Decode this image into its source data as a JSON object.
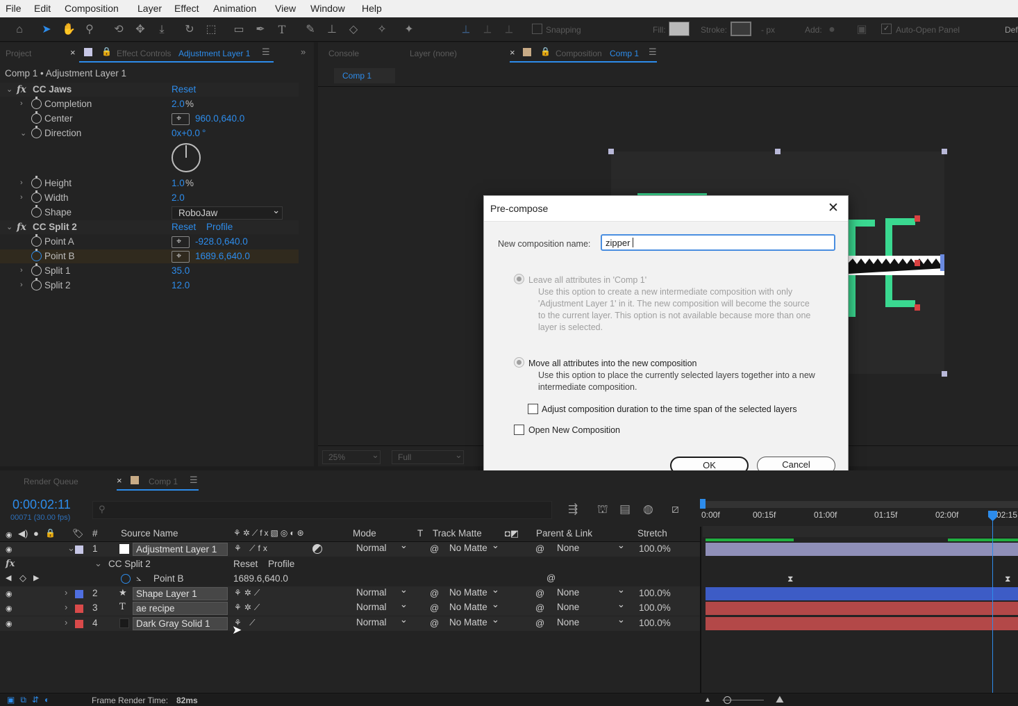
{
  "menu": [
    "File",
    "Edit",
    "Composition",
    "Layer",
    "Effect",
    "Animation",
    "View",
    "Window",
    "Help"
  ],
  "toolbar": {
    "snapping": "Snapping",
    "fill": "Fill:",
    "stroke": "Stroke:",
    "stroke_px": "- px",
    "add": "Add:",
    "auto_open": "Auto-Open Panel",
    "workspace": "Def"
  },
  "left_panel": {
    "tab_project": "Project",
    "tab_effect_controls": "Effect Controls",
    "tab_effect_target": "Adjustment Layer 1",
    "header": "Comp 1 • Adjustment Layer 1",
    "effects": [
      {
        "name": "CC Jaws",
        "reset": "Reset",
        "props": [
          {
            "label": "Completion",
            "value": "2.0",
            "unit": "%"
          },
          {
            "label": "Center",
            "value": "960.0,640.0"
          },
          {
            "label": "Direction",
            "value": "0x+0.0",
            "unit": "°"
          },
          {
            "label": "Height",
            "value": "1.0",
            "unit": "%"
          },
          {
            "label": "Width",
            "value": "2.0"
          },
          {
            "label": "Shape",
            "value": "RoboJaw"
          }
        ]
      },
      {
        "name": "CC Split 2",
        "reset": "Reset",
        "profile": "Profile",
        "props": [
          {
            "label": "Point A",
            "value": "-928.0,640.0"
          },
          {
            "label": "Point B",
            "value": "1689.6,640.0"
          },
          {
            "label": "Split 1",
            "value": "35.0"
          },
          {
            "label": "Split 2",
            "value": "12.0"
          }
        ]
      }
    ]
  },
  "comp_panel": {
    "tab_console": "Console",
    "tab_layer": "Layer (none)",
    "tab_composition": "Composition",
    "tab_comp_name": "Comp 1",
    "breadcrumb": "Comp 1",
    "zoom": "25%",
    "resolution": "Full"
  },
  "dialog": {
    "title": "Pre-compose",
    "name_label": "New composition name:",
    "name_value": "zipper",
    "opt1_label": "Leave all attributes in 'Comp 1'",
    "opt1_desc": [
      "Use this option to create a new intermediate composition with only",
      "'Adjustment Layer 1' in it. The new composition will become the source",
      "to the current layer. This option is not available because more than one",
      "layer is selected."
    ],
    "opt2_label": "Move all attributes into the new composition",
    "opt2_desc": [
      "Use this option to place the currently selected layers together into a new",
      "intermediate composition."
    ],
    "adjust_duration": "Adjust composition duration to the time span of the selected layers",
    "open_new": "Open New Composition",
    "ok": "OK",
    "cancel": "Cancel"
  },
  "timeline": {
    "tab_render_queue": "Render Queue",
    "tab_comp": "Comp 1",
    "timecode": "0:00:02:11",
    "frame_info": "00071 (30.00 fps)",
    "columns": {
      "num": "#",
      "source_name": "Source Name",
      "mode": "Mode",
      "t": "T",
      "track_matte": "Track Matte",
      "parent_link": "Parent & Link",
      "stretch": "Stretch"
    },
    "ruler": [
      "0:00f",
      "00:15f",
      "01:00f",
      "01:15f",
      "02:00f",
      "02:15"
    ],
    "layers": [
      {
        "num": "1",
        "name": "Adjustment Layer 1",
        "mode": "Normal",
        "matte": "No Matte",
        "parent": "None",
        "stretch": "100.0%",
        "color": "#c7c7e6",
        "bar": "#8f8fb8"
      },
      {
        "num": "2",
        "name": "Shape Layer 1",
        "mode": "Normal",
        "matte": "No Matte",
        "parent": "None",
        "stretch": "100.0%",
        "color": "#4f6fe0",
        "bar": "#3d5cc6"
      },
      {
        "num": "3",
        "name": "ae recipe",
        "mode": "Normal",
        "matte": "No Matte",
        "parent": "None",
        "stretch": "100.0%",
        "color": "#d94a4a",
        "bar": "#b34848"
      },
      {
        "num": "4",
        "name": "Dark Gray Solid 1",
        "mode": "Normal",
        "matte": "No Matte",
        "parent": "None",
        "stretch": "100.0%",
        "color": "#d94a4a",
        "bar": "#b34848"
      }
    ],
    "sub_effect": {
      "name": "CC Split 2",
      "reset": "Reset",
      "profile": "Profile",
      "prop": "Point B",
      "value": "1689.6,640.0"
    }
  },
  "status": {
    "label": "Frame Render Time:",
    "value": "82ms"
  }
}
